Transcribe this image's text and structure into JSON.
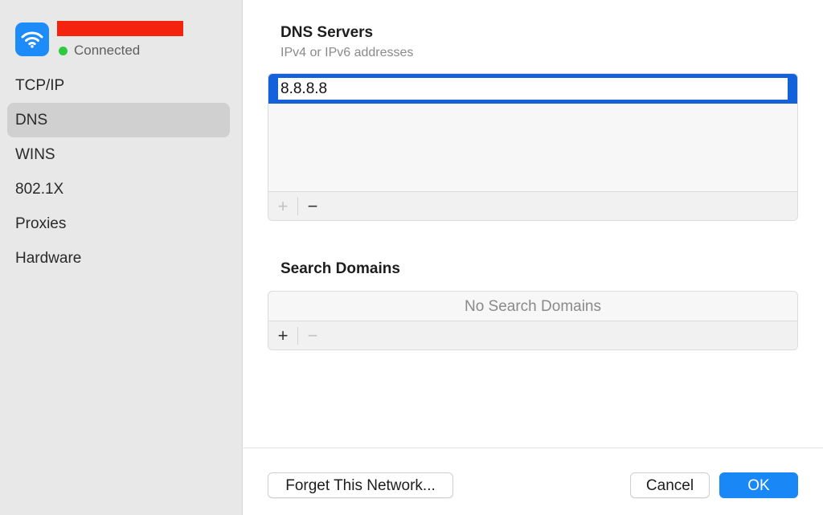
{
  "network": {
    "icon": "wifi-icon",
    "status": "Connected",
    "status_color": "#2dc93f",
    "name_redacted_color": "#f4230f"
  },
  "sidebar": {
    "items": [
      {
        "label": "TCP/IP",
        "selected": false
      },
      {
        "label": "DNS",
        "selected": true
      },
      {
        "label": "WINS",
        "selected": false
      },
      {
        "label": "802.1X",
        "selected": false
      },
      {
        "label": "Proxies",
        "selected": false
      },
      {
        "label": "Hardware",
        "selected": false
      }
    ]
  },
  "dns_servers": {
    "title": "DNS Servers",
    "subtitle": "IPv4 or IPv6 addresses",
    "entries": [
      "8.8.8.8"
    ],
    "add_label": "+",
    "remove_label": "−"
  },
  "search_domains": {
    "title": "Search Domains",
    "empty_text": "No Search Domains",
    "add_label": "+",
    "remove_label": "−"
  },
  "footer": {
    "forget_label": "Forget This Network...",
    "cancel_label": "Cancel",
    "ok_label": "OK"
  },
  "colors": {
    "accent": "#1a87f6",
    "selection": "#1462d9",
    "wifi_badge": "#1e8cf8"
  }
}
